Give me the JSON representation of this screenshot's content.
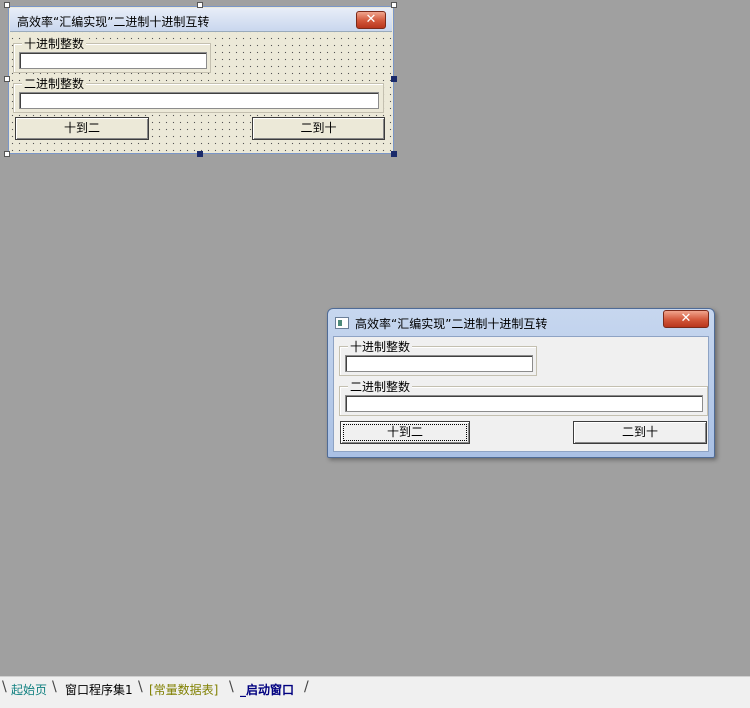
{
  "window_title": "高效率“汇编实现”二进制十进制互转",
  "close_glyph": "✕",
  "group_decimal_label": "十进制整数",
  "group_binary_label": "二进制整数",
  "decimal_value": "",
  "binary_value": "",
  "btn_dec_to_bin": "十到二",
  "btn_bin_to_dec": "二到十",
  "tabs": [
    {
      "label": "起始页",
      "color": "#108080"
    },
    {
      "label": "窗口程序集1",
      "color": "#000000"
    },
    {
      "label": "[常量数据表]",
      "color": "#808000"
    },
    {
      "label": "_启动窗口",
      "color": "#000080",
      "active": true
    }
  ],
  "colors": {
    "workspace_bg": "#a0a0a0",
    "close_red": "#d2573a"
  }
}
